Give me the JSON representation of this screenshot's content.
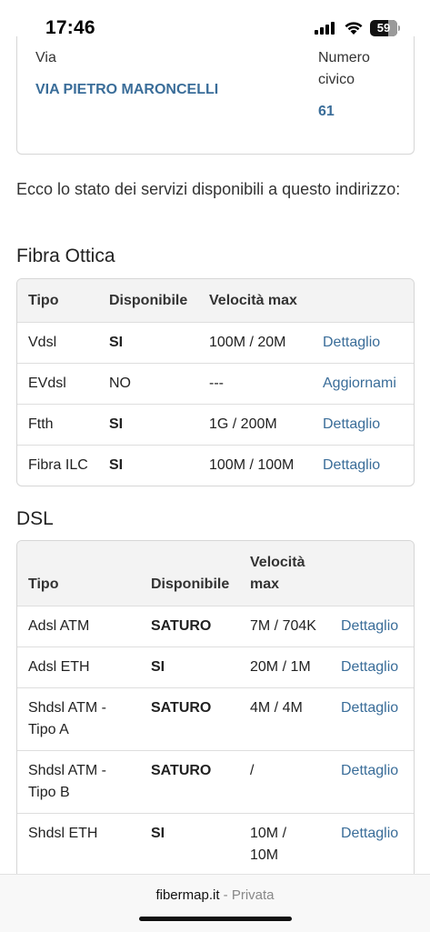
{
  "status": {
    "time": "17:46",
    "battery": "59"
  },
  "address": {
    "via_label": "Via",
    "via_value": "VIA PIETRO MARONCELLI",
    "civic_label_1": "Numero",
    "civic_label_2": "civico",
    "civic_value": "61"
  },
  "intro_text": "Ecco lo stato dei servizi disponibili a questo indirizzo:",
  "fibra": {
    "title": "Fibra Ottica",
    "headers": {
      "tipo": "Tipo",
      "disponibile": "Disponibile",
      "velocita": "Velocità max"
    },
    "rows": [
      {
        "tipo": "Vdsl",
        "disponibile": "SI",
        "velocita": "100M / 20M",
        "action": "Dettaglio"
      },
      {
        "tipo": "EVdsl",
        "disponibile": "NO",
        "velocita": "---",
        "action": "Aggiornami"
      },
      {
        "tipo": "Ftth",
        "disponibile": "SI",
        "velocita": "1G / 200M",
        "action": "Dettaglio"
      },
      {
        "tipo": "Fibra ILC",
        "disponibile": "SI",
        "velocita": "100M / 100M",
        "action": "Dettaglio"
      }
    ]
  },
  "dsl": {
    "title": "DSL",
    "headers": {
      "tipo": "Tipo",
      "disponibile": "Disponibile",
      "velocita_1": "Velocità",
      "velocita_2": "max"
    },
    "rows": [
      {
        "tipo_1": "Adsl ATM",
        "tipo_2": "",
        "disponibile": "SATURO",
        "velocita_1": "7M / 704K",
        "velocita_2": "",
        "action": "Dettaglio"
      },
      {
        "tipo_1": "Adsl ETH",
        "tipo_2": "",
        "disponibile": "SI",
        "velocita_1": "20M / 1M",
        "velocita_2": "",
        "action": "Dettaglio"
      },
      {
        "tipo_1": "Shdsl ATM -",
        "tipo_2": "Tipo A",
        "disponibile": "SATURO",
        "velocita_1": "4M / 4M",
        "velocita_2": "",
        "action": "Dettaglio"
      },
      {
        "tipo_1": "Shdsl ATM -",
        "tipo_2": "Tipo B",
        "disponibile": "SATURO",
        "velocita_1": "/",
        "velocita_2": "",
        "action": "Dettaglio"
      },
      {
        "tipo_1": "Shdsl ETH",
        "tipo_2": "",
        "disponibile": "SI",
        "velocita_1": "10M /",
        "velocita_2": "10M",
        "action": "Dettaglio"
      }
    ]
  },
  "browser": {
    "host": "fibermap.it",
    "separator": " - ",
    "mode": "Privata"
  }
}
